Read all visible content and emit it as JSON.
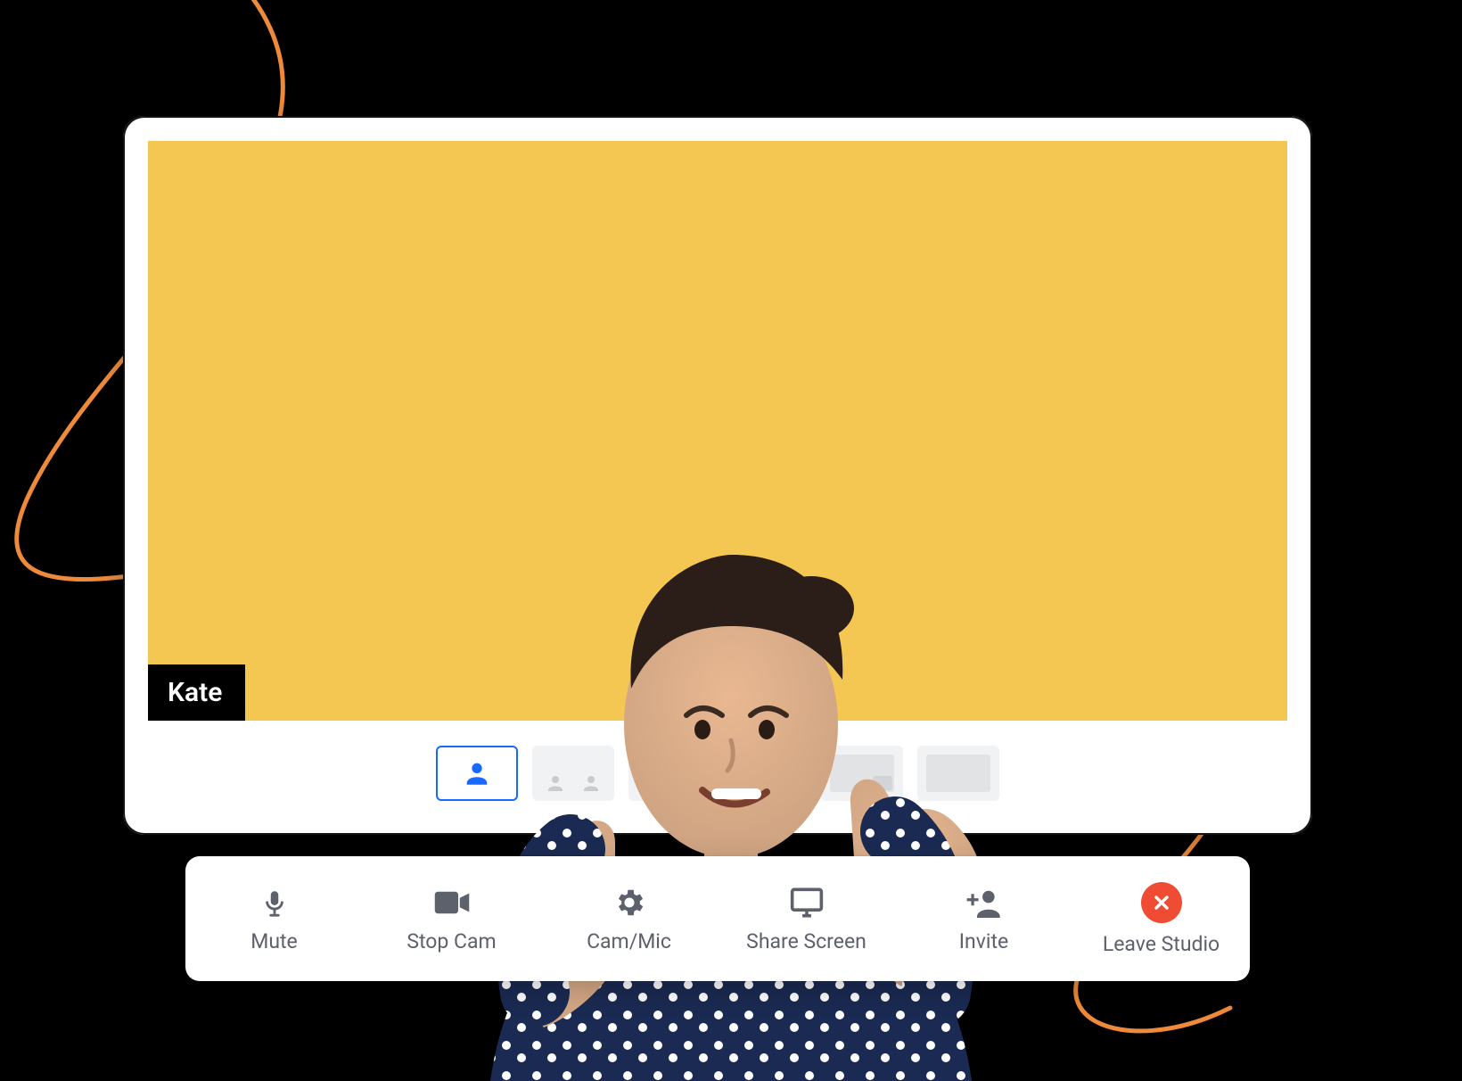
{
  "colors": {
    "video_bg": "#f4c752",
    "accent": "#1869ff",
    "leave": "#ef4c33",
    "swoosh": "#ee8a3a",
    "toolbar_icon": "#5d616c"
  },
  "participant": {
    "name": "Kate"
  },
  "layouts": [
    {
      "id": "single",
      "selected": true
    },
    {
      "id": "two-up",
      "selected": false
    },
    {
      "id": "three-up",
      "selected": false
    },
    {
      "id": "screen-right",
      "selected": false
    },
    {
      "id": "screen-pip",
      "selected": false
    },
    {
      "id": "blank",
      "selected": false
    }
  ],
  "toolbar": {
    "mute": "Mute",
    "stop_cam": "Stop Cam",
    "cam_mic": "Cam/Mic",
    "share_screen": "Share Screen",
    "invite": "Invite",
    "leave_studio": "Leave Studio"
  }
}
